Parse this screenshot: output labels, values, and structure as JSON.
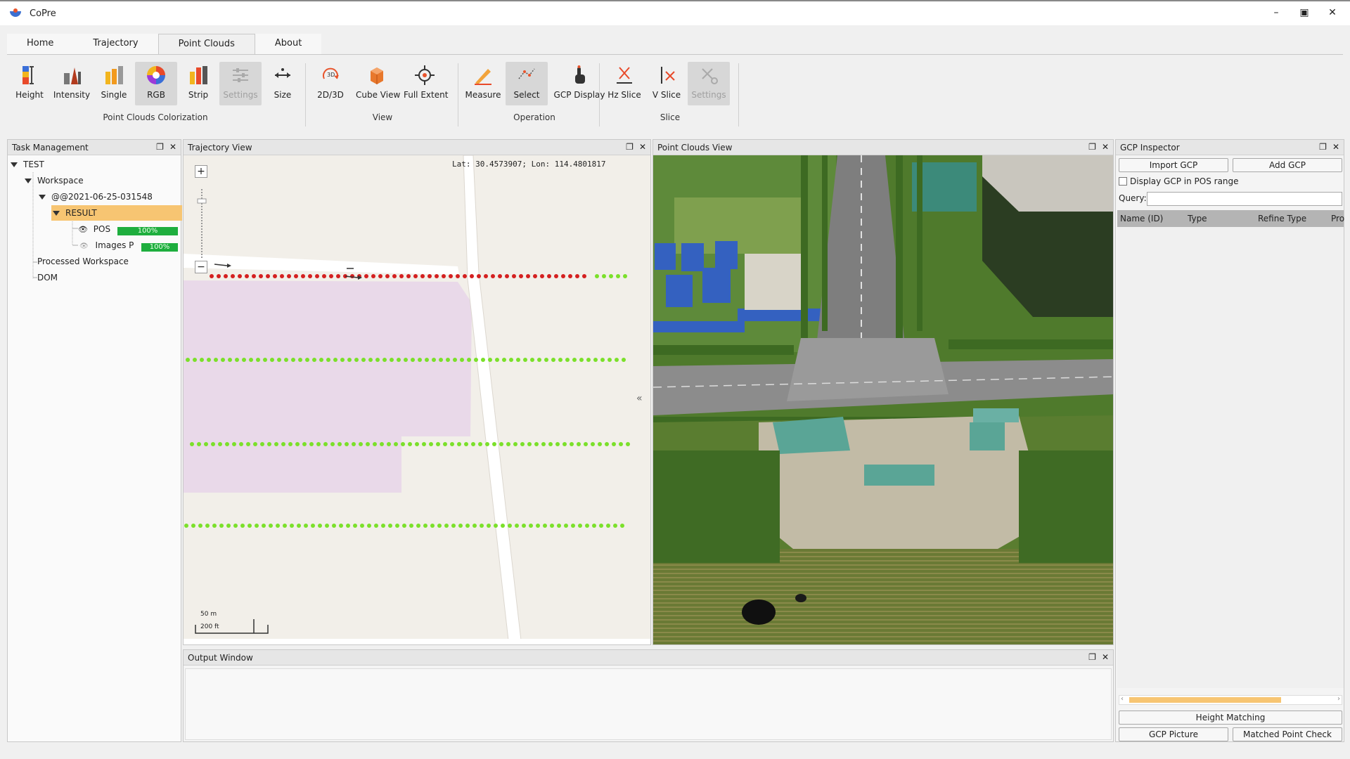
{
  "window": {
    "title": "CoPre",
    "controls": [
      "–",
      "▣",
      "✕"
    ]
  },
  "tabs": [
    {
      "label": "Home",
      "active": false
    },
    {
      "label": "Trajectory",
      "active": false
    },
    {
      "label": "Point Clouds",
      "active": true
    },
    {
      "label": "About",
      "active": false
    }
  ],
  "ribbon": {
    "colorization": {
      "label": "Point Clouds Colorization",
      "buttons": {
        "height": "Height",
        "intensity": "Intensity",
        "single": "Single",
        "rgb": "RGB",
        "strip": "Strip",
        "settings": "Settings",
        "size": "Size"
      }
    },
    "view": {
      "label": "View",
      "buttons": {
        "view2d3d": "2D/3D",
        "cube": "Cube View",
        "extent": "Full Extent"
      }
    },
    "operation": {
      "label": "Operation",
      "buttons": {
        "measure": "Measure",
        "select": "Select",
        "gcp": "GCP Display"
      }
    },
    "slice": {
      "label": "Slice",
      "buttons": {
        "hz": "Hz Slice",
        "v": "V Slice",
        "settings": "Settings"
      }
    }
  },
  "task_panel": {
    "title": "Task Management",
    "tree": {
      "root": "TEST",
      "workspace": "Workspace",
      "dataset": "@@2021-06-25-031548",
      "result": "RESULT",
      "pos": {
        "label": "POS",
        "progress": "100%",
        "progress_value": 1.0
      },
      "images": {
        "label": "Images P",
        "progress": "100%",
        "progress_value": 1.0
      },
      "processed": "Processed Workspace",
      "dom": "DOM"
    }
  },
  "trajectory_panel": {
    "title": "Trajectory View",
    "coords": "Lat: 30.4573907; Lon: 114.4801817",
    "scale_m": "50 m",
    "scale_ft": "200 ft",
    "collapse": "«"
  },
  "pointcloud_panel": {
    "title": "Point Clouds View"
  },
  "gcp_panel": {
    "title": "GCP Inspector",
    "import_btn": "Import GCP",
    "add_btn": "Add GCP",
    "display_check": "Display GCP in POS range",
    "display_checked": false,
    "query_label": "Query:",
    "query_value": "",
    "columns": [
      "Name (ID)",
      "Type",
      "Refine Type",
      "Pro"
    ],
    "height_btn": "Height Matching",
    "picture_btn": "GCP Picture",
    "matched_btn": "Matched Point Check"
  },
  "output_panel": {
    "title": "Output Window"
  },
  "colors": {
    "trajectory_red": "#d42020",
    "trajectory_green": "#7be02a",
    "progress_green": "#1eae3e",
    "highlight": "#f7c572",
    "parcel": "#e9d9e9"
  }
}
